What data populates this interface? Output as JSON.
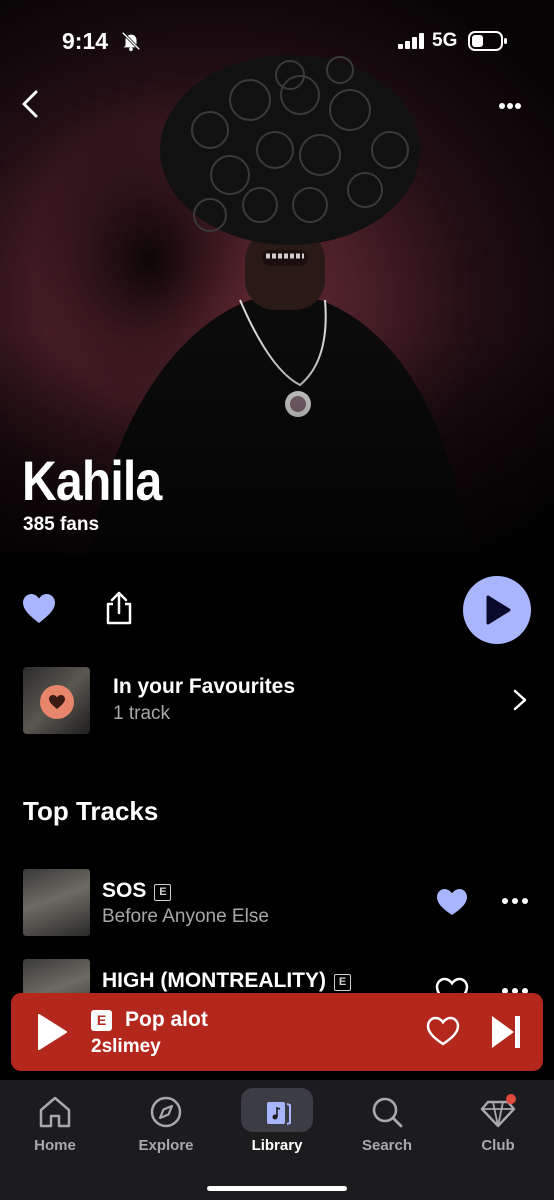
{
  "status_bar": {
    "time": "9:14",
    "network": "5G"
  },
  "artist": {
    "name": "Kahila",
    "fans": "385 fans"
  },
  "favourites": {
    "title": "In your Favourites",
    "subtitle": "1 track"
  },
  "top_tracks": {
    "heading": "Top Tracks",
    "items": [
      {
        "title": "SOS",
        "explicit": "E",
        "subtitle": "Before Anyone Else",
        "liked": true
      },
      {
        "title": "HIGH (MONTREALITY)",
        "explicit": "E",
        "subtitle": "",
        "liked": false
      }
    ]
  },
  "now_playing": {
    "explicit": "E",
    "title": "Pop alot",
    "artist": "2slimey"
  },
  "tabs": [
    {
      "label": "Home",
      "icon": "home-icon"
    },
    {
      "label": "Explore",
      "icon": "compass-icon"
    },
    {
      "label": "Library",
      "icon": "library-icon",
      "active": true
    },
    {
      "label": "Search",
      "icon": "search-icon"
    },
    {
      "label": "Club",
      "icon": "diamond-icon"
    }
  ],
  "colors": {
    "accent": "#a9b6ff",
    "mini_player": "#b3271d",
    "favourite_badge": "#e8866b"
  }
}
